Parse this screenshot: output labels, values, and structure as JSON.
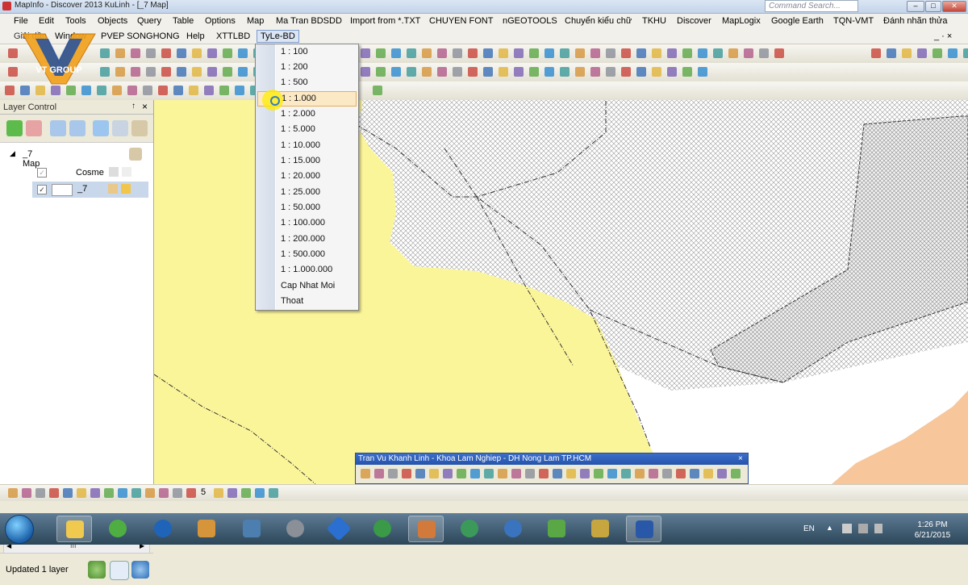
{
  "window": {
    "title": "MapInfo - Discover 2013   KuLinh - [_7 Map]",
    "command_search_placeholder": "Command Search...",
    "mdi_controls": "_ · ×"
  },
  "menubar": {
    "row1": [
      "File",
      "Edit",
      "Tools",
      "Objects",
      "Query",
      "Table",
      "Options",
      "Map",
      "Ma Tran BDSDD",
      "Import from *.TXT",
      "CHUYEN FONT",
      "nGEOTOOLS",
      "Chuyển kiểu chữ",
      "TKHU",
      "Discover",
      "MapLogix",
      "Google Earth",
      "TQN-VMT",
      "Đánh nhãn thửa"
    ],
    "row2": [
      "Window",
      "PVEP SONGHONG",
      "Help",
      "XTTLBD",
      "TyLe-BD"
    ],
    "row2_first_partial": "Giải dần",
    "active": "TyLe-BD"
  },
  "dropdown": {
    "items": [
      "1 : 100",
      "1 : 200",
      "1 : 500",
      "1 : 1.000",
      "1 : 2.000",
      "1 : 5.000",
      "1 : 10.000",
      "1 : 15.000",
      "1 : 20.000",
      "1 : 25.000",
      "1 : 50.000",
      "1 : 100.000",
      "1 : 200.000",
      "1 : 500.000",
      "1 : 1.000.000",
      "Cap Nhat Moi",
      "Thoat"
    ],
    "highlighted": "1 : 1.000"
  },
  "layer_control": {
    "title": "Layer Control",
    "pin": "↑",
    "close": "×",
    "root_label": "_7 Map",
    "layers": [
      {
        "name": "Cosme",
        "checked": true
      },
      {
        "name": "_7",
        "checked": true
      }
    ],
    "status": "Updated 1 layer",
    "scroll_glyph": "III"
  },
  "floating_toolbar": {
    "title": "Tran Vu Khanh Linh - Khoa Lam Nghiep - DH Nong Lam TP.HCM",
    "close": "×"
  },
  "bottom_toolbar": {
    "number_label": "5"
  },
  "taskbar": {
    "language": "EN",
    "time": "1:26 PM",
    "date": "6/21/2015"
  },
  "logo": {
    "text": "VT GROUP"
  },
  "colors": {
    "map_yellow": "#fbf59a",
    "map_peach": "#f7c69b",
    "menu_highlight": "#fbe9c6",
    "caption_blue": "#2453ad"
  }
}
